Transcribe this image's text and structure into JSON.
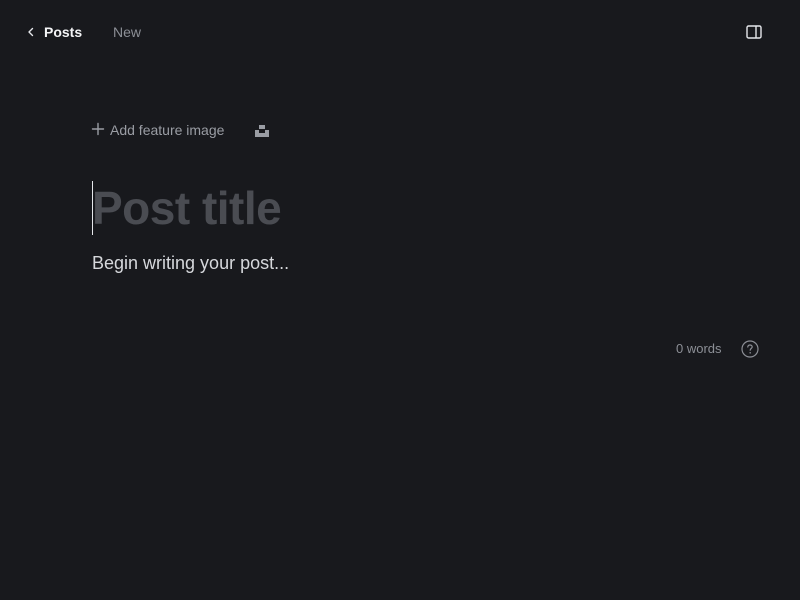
{
  "header": {
    "back_label": "Posts",
    "status": "New",
    "back_icon": "chevron-left-icon",
    "sidebar_icon": "sidebar-panel-icon"
  },
  "editor": {
    "add_feature_label": "Add feature image",
    "add_feature_icon": "plus-icon",
    "unsplash_icon": "unsplash-icon",
    "title_placeholder": "Post title",
    "body_placeholder": "Begin writing your post..."
  },
  "footer": {
    "word_count": "0 words",
    "help_icon": "question-circle-icon"
  },
  "colors": {
    "background": "#18191d",
    "text_primary": "#f3f4f6",
    "text_muted": "#8c8f96",
    "title_placeholder": "#4a4c52"
  }
}
